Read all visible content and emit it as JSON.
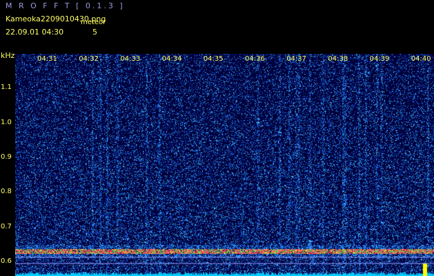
{
  "header": {
    "app_title": "M R O F F T [ 0.1.3 ]",
    "file_name": "Kameoka2209010430.png",
    "type_label": "meteor",
    "date_time": "22.09.01 04:30",
    "count": "5"
  },
  "chart_data": {
    "type": "heatmap",
    "title": "",
    "x": {
      "unit": "",
      "ticks": [
        "04:31",
        "04:32",
        "04:33",
        "04:34",
        "04:35",
        "04:36",
        "04:37",
        "04:38",
        "04:39",
        "04:40"
      ]
    },
    "y": {
      "unit": "kHz",
      "ticks": [
        "1.1",
        "1.0",
        "0.9",
        "0.8",
        "0.7",
        "0.6"
      ],
      "range": [
        0.56,
        1.2
      ]
    },
    "carrier_kHz": 0.632,
    "meteor_count": 5,
    "grid": false,
    "colors": {
      "background": "#000040",
      "noise": "#2266ff",
      "carrier": "#ff3366",
      "floor": "#00ccff",
      "accent": "#ffff00"
    }
  }
}
